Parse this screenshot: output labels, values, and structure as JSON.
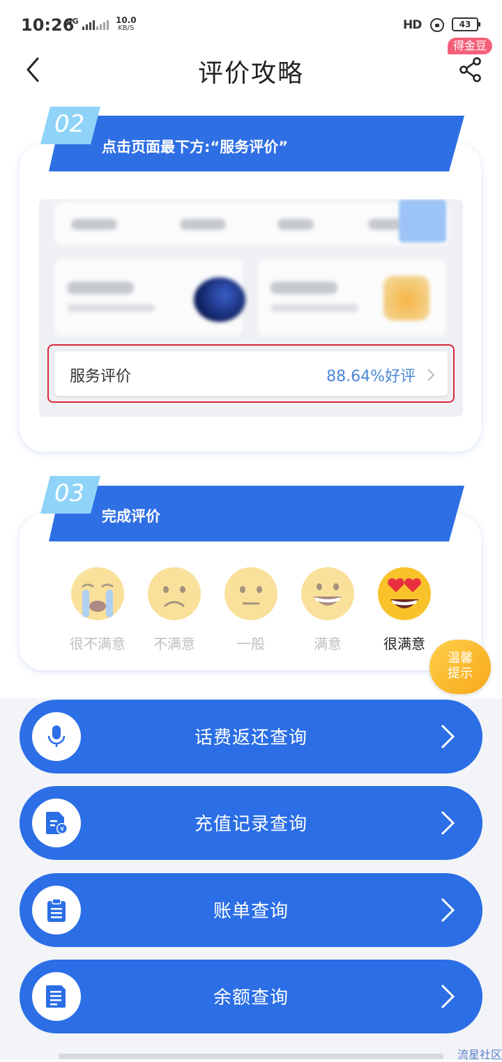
{
  "status_bar": {
    "time": "10:26",
    "network": "4G",
    "speed_value": "10.0",
    "speed_unit": "KB/S",
    "hd_label": "HD",
    "battery": "43"
  },
  "header": {
    "title": "评价攻略",
    "badge": "得金豆",
    "back_icon": "chevron-left-icon",
    "share_icon": "share-icon"
  },
  "step2": {
    "number": "02",
    "title": "点击页面最下方:“服务评价”",
    "rating_label": "服务评价",
    "rating_value": "88.64%好评"
  },
  "step3": {
    "number": "03",
    "title": "完成评价",
    "options": [
      {
        "label": "很不满意",
        "icon": "crying-face-icon"
      },
      {
        "label": "不满意",
        "icon": "frowning-face-icon"
      },
      {
        "label": "一般",
        "icon": "neutral-face-icon"
      },
      {
        "label": "满意",
        "icon": "grinning-face-icon"
      },
      {
        "label": "很满意",
        "icon": "heart-eyes-face-icon",
        "selected": true
      }
    ]
  },
  "tip_button": {
    "line1": "温馨",
    "line2": "提示"
  },
  "query_buttons": [
    {
      "label": "话费返还查询",
      "icon": "microphone-icon"
    },
    {
      "label": "充值记录查询",
      "icon": "yuan-document-icon"
    },
    {
      "label": "账单查询",
      "icon": "clipboard-icon"
    },
    {
      "label": "余额查询",
      "icon": "document-icon"
    }
  ],
  "watermark": "流星社区",
  "colors": {
    "primary_blue": "#2b6ee6",
    "banner_blue": "#2f6fe4",
    "badge_pink": "#f4607a",
    "tip_orange": "#f7a818",
    "highlight_red": "#d9283a"
  }
}
